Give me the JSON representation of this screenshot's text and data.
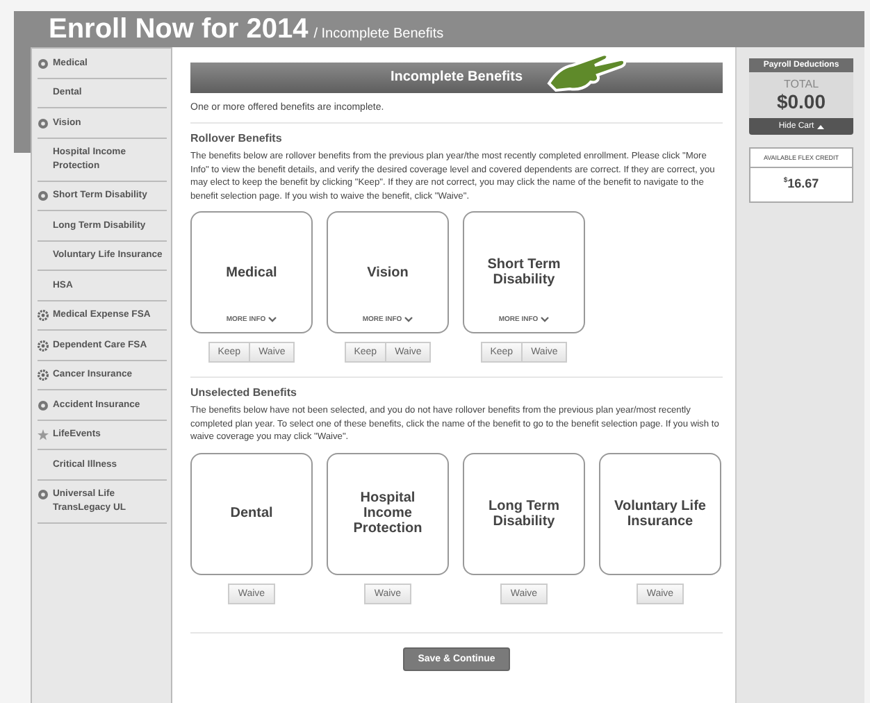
{
  "header": {
    "title": "Enroll Now for 2014",
    "crumb": "/ Incomplete Benefits"
  },
  "sidebar": {
    "items": [
      {
        "label": "Medical",
        "kind": "status"
      },
      {
        "label": "Dental",
        "kind": "plain"
      },
      {
        "label": "Vision",
        "kind": "status"
      },
      {
        "label": "Hospital Income Protection",
        "kind": "plain"
      },
      {
        "label": "Short Term Disability",
        "kind": "status"
      },
      {
        "label": "Long Term Disability",
        "kind": "plain"
      },
      {
        "label": "Voluntary Life Insurance",
        "kind": "plain"
      },
      {
        "label": "HSA",
        "kind": "plain"
      },
      {
        "label": "Medical Expense FSA",
        "kind": "gear"
      },
      {
        "label": "Dependent Care FSA",
        "kind": "gear"
      },
      {
        "label": "Cancer Insurance",
        "kind": "gear"
      },
      {
        "label": "Accident Insurance",
        "kind": "status"
      },
      {
        "label": "LifeEvents",
        "kind": "star"
      },
      {
        "label": "Critical Illness",
        "kind": "plain"
      },
      {
        "label": "Universal Life TransLegacy UL",
        "kind": "status"
      }
    ]
  },
  "main": {
    "title": "Incomplete Benefits",
    "notice": "One or more offered benefits are incomplete.",
    "rollover": {
      "heading": "Rollover Benefits",
      "text": "The benefits below are rollover benefits from the previous plan year/the most recently completed enrollment. Please click \"More Info\" to view the benefit details, and verify the desired coverage level and covered dependents are correct. If they are correct, you may elect to keep the benefit by clicking \"Keep\". If they are not correct, you may click the name of the benefit to navigate to the benefit selection page. If you wish to waive the benefit, click \"Waive\".",
      "cards": [
        {
          "name": "Medical",
          "more": "MORE INFO",
          "keep": "Keep",
          "waive": "Waive"
        },
        {
          "name": "Vision",
          "more": "MORE INFO",
          "keep": "Keep",
          "waive": "Waive"
        },
        {
          "name": "Short Term Disability",
          "more": "MORE INFO",
          "keep": "Keep",
          "waive": "Waive"
        }
      ]
    },
    "unselected": {
      "heading": "Unselected Benefits",
      "text": "The benefits below have not been selected, and you do not have rollover benefits from the previous plan year/most recently completed plan year. To select one of these benefits, click the name of the benefit to go to the benefit selection page. If you wish to waive coverage you may click \"Waive\".",
      "cards": [
        {
          "name": "Dental",
          "waive": "Waive"
        },
        {
          "name": "Hospital Income Protection",
          "waive": "Waive"
        },
        {
          "name": "Long Term Disability",
          "waive": "Waive"
        },
        {
          "name": "Voluntary Life Insurance",
          "waive": "Waive"
        }
      ]
    },
    "save": "Save & Continue"
  },
  "cart": {
    "title": "Payroll Deductions",
    "total_label": "TOTAL",
    "total": "$0.00",
    "hide": "Hide Cart",
    "flex_label": "AVAILABLE FLEX CREDIT",
    "flex_currency": "$",
    "flex": "16.67"
  }
}
